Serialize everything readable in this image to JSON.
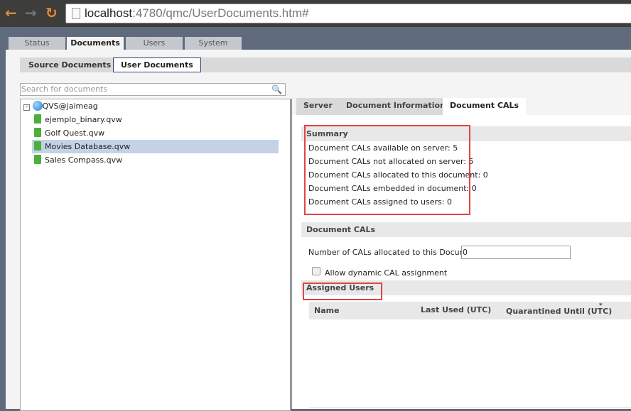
{
  "browser": {
    "url_host": "localhost",
    "url_rest": ":4780/qmc/UserDocuments.htm#"
  },
  "main_tabs": [
    "Status",
    "Documents",
    "Users",
    "System"
  ],
  "sub_tabs": [
    "Source Documents",
    "User Documents"
  ],
  "search": {
    "placeholder": "Search for documents"
  },
  "tree": {
    "root": "QVS@jaimeag",
    "items": [
      "ejemplo_binary.qvw",
      "Golf Quest.qvw",
      "Movies Database.qvw",
      "Sales Compass.qvw"
    ],
    "selected": "Movies Database.qvw"
  },
  "detail_tabs": [
    "Server",
    "Document Information",
    "Document CALs"
  ],
  "summary": {
    "title": "Summary",
    "lines": [
      "Document CALs available on server: 5",
      "Document CALs not allocated on server: 5",
      "Document CALs allocated to this document: 0",
      "Document CALs embedded in document: 0",
      "Document CALs assigned to users: 0"
    ]
  },
  "document_cals": {
    "title": "Document CALs",
    "number_label": "Number of CALs allocated to this Document:",
    "number_value": "0",
    "dynamic_label": "Allow dynamic CAL assignment",
    "dynamic_checked": false
  },
  "assigned_users": {
    "title": "Assigned Users",
    "columns": [
      "Name",
      "Last Used (UTC)",
      "Quarantined Until (UTC)"
    ],
    "asterisk": "*"
  }
}
